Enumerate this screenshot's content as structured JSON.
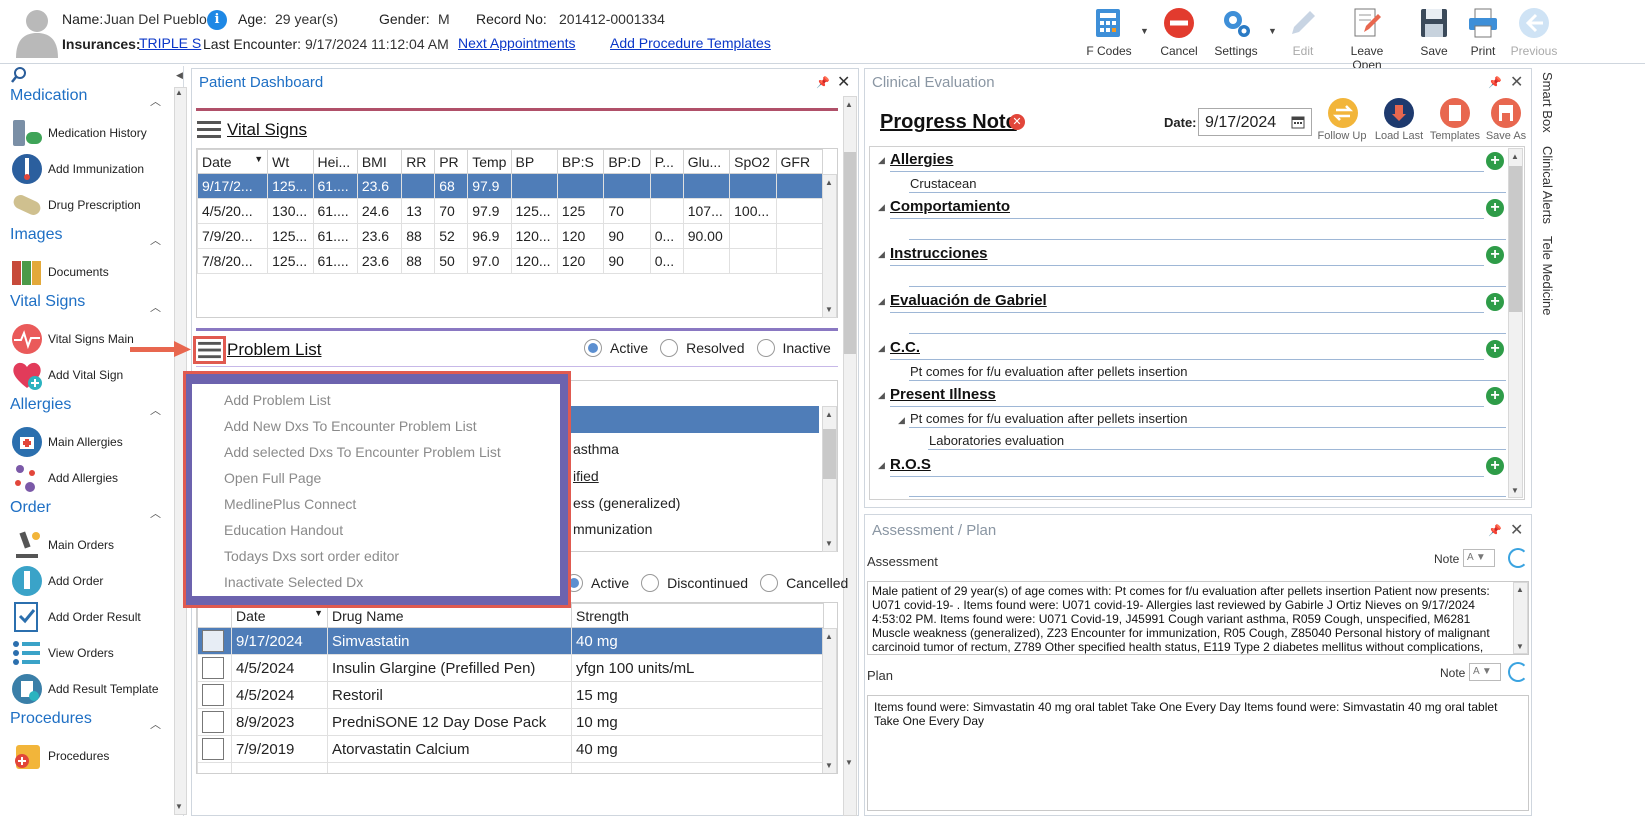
{
  "patient": {
    "name_label": "Name:",
    "name": "Juan Del Pueblo",
    "age_label": "Age:",
    "age": "29 year(s)",
    "gender_label": "Gender:",
    "gender": "M",
    "record_label": "Record No:",
    "record": "201412-0001334",
    "insurances_label": "Insurances:",
    "insurance": "TRIPLE S",
    "last_encounter_label": "Last Encounter:",
    "last_encounter": "9/17/2024 11:12:04 AM",
    "next_appointments": "Next Appointments",
    "add_procedure_templates": "Add Procedure Templates"
  },
  "toolbar": {
    "fcodes": "F Codes",
    "cancel": "Cancel",
    "settings": "Settings",
    "edit": "Edit",
    "leave_open": "Leave Open",
    "save": "Save",
    "print": "Print",
    "previous": "Previous"
  },
  "sidebar": {
    "sections": [
      {
        "title": "Medication",
        "items": [
          "Medication History",
          "Add Immunization",
          "Drug Prescription"
        ]
      },
      {
        "title": "Images",
        "items": [
          "Documents"
        ]
      },
      {
        "title": "Vital Signs",
        "items": [
          "Vital Signs Main",
          "Add Vital Sign"
        ]
      },
      {
        "title": "Allergies",
        "items": [
          "Main Allergies",
          "Add Allergies"
        ]
      },
      {
        "title": "Order",
        "items": [
          "Main Orders",
          "Add Order",
          "Add Order Result",
          "View Orders",
          "Add Result Template"
        ]
      },
      {
        "title": "Procedures",
        "items": [
          "Procedures"
        ]
      }
    ]
  },
  "dashboard": {
    "title": "Patient Dashboard",
    "vital_signs": {
      "title": "Vital Signs",
      "columns": [
        "Date",
        "Wt",
        "Hei...",
        "BMI",
        "RR",
        "PR",
        "Temp",
        "BP",
        "BP:S",
        "BP:D",
        "P...",
        "Glu...",
        "SpO2",
        "GFR"
      ],
      "rows": [
        [
          "9/17/2...",
          "125...",
          "61....",
          "23.6",
          "",
          "68",
          "97.9",
          "",
          "",
          "",
          "",
          "",
          "",
          ""
        ],
        [
          "4/5/20...",
          "130...",
          "61....",
          "24.6",
          "13",
          "70",
          "97.9",
          "125...",
          "125",
          "70",
          "",
          "107...",
          "100...",
          ""
        ],
        [
          "7/9/20...",
          "125...",
          "61....",
          "23.6",
          "88",
          "52",
          "96.9",
          "120...",
          "120",
          "90",
          "0...",
          "90.00",
          "",
          ""
        ],
        [
          "7/8/20...",
          "125...",
          "61....",
          "23.6",
          "88",
          "50",
          "97.0",
          "120...",
          "120",
          "90",
          "0...",
          "",
          "",
          ""
        ]
      ]
    },
    "problem_list": {
      "title": "Problem List",
      "filters": [
        "Active",
        "Resolved",
        "Inactive"
      ],
      "selected_filter": "Active",
      "visible_fragments": [
        "asthma",
        "ified",
        "ess (generalized)",
        "mmunization"
      ]
    },
    "context_menu": {
      "items": [
        "Add Problem List",
        "Add New Dxs To Encounter Problem List",
        "Add selected Dxs To Encounter Problem List",
        "Open Full Page",
        "MedlinePlus Connect",
        "Education Handout",
        "Todays Dxs sort order editor",
        "Inactivate Selected Dx"
      ]
    },
    "medications": {
      "filters": [
        "Active",
        "Discontinued",
        "Cancelled"
      ],
      "columns": [
        "Date",
        "Drug Name",
        "Strength"
      ],
      "rows": [
        [
          "9/17/2024",
          "Simvastatin",
          "40 mg"
        ],
        [
          "4/5/2024",
          "Insulin Glargine (Prefilled Pen)",
          "yfgn 100 units/mL"
        ],
        [
          "4/5/2024",
          "Restoril",
          "15 mg"
        ],
        [
          "8/9/2023",
          "PredniSONE 12 Day Dose Pack",
          "10 mg"
        ],
        [
          "7/9/2019",
          "Atorvastatin Calcium",
          "40 mg"
        ]
      ]
    }
  },
  "clinical": {
    "title": "Clinical Evaluation",
    "note_title": "Progress Note",
    "date_label": "Date:",
    "date": "9/17/2024",
    "actions": [
      "Follow Up",
      "Load Last",
      "Templates",
      "Save As"
    ],
    "sections": [
      {
        "title": "Allergies",
        "lines": [
          "Crustacean"
        ]
      },
      {
        "title": "Comportamiento",
        "lines": []
      },
      {
        "title": "Instrucciones",
        "lines": []
      },
      {
        "title": "Evaluación de Gabriel",
        "lines": []
      },
      {
        "title": "C.C.",
        "lines": [
          "Pt comes for f/u evaluation after pellets insertion"
        ]
      },
      {
        "title": "Present Illness",
        "lines": [
          "Pt comes for f/u evaluation after pellets insertion",
          "Laboratories evaluation"
        ]
      },
      {
        "title": "R.O.S",
        "lines": []
      }
    ]
  },
  "side_tabs": [
    "Smart Box",
    "Clinical Alerts",
    "Tele Medicine"
  ],
  "assessment_plan": {
    "title": "Assessment / Plan",
    "assessment_label": "Assessment",
    "note_label": "Note",
    "assessment_text": "Male patient of 29 year(s) of age comes with:  Pt comes for f/u evaluation after pellets insertion  Patient now presents: U071 covid-19- . Items found were:  U071 covid-19-    Allergies last reviewed by Gabirle J Ortiz Nieves on 9/17/2024 4:53:02 PM.     Items found were:  U071 Covid-19, J45991 Cough variant asthma, R059 Cough, unspecified, M6281 Muscle weakness (generalized), Z23 Encounter for immunization, R05 Cough, Z85040 Personal history of malignant carcinoid tumor of rectum, Z789 Other specified health status, E119 Type 2 diabetes mellitus without complications,",
    "plan_label": "Plan",
    "plan_text": "  Items found were:  Simvastatin 40 mg oral tablet Take One Every Day   Items found were:  Simvastatin 40 mg oral tablet Take One Every Day"
  },
  "colors": {
    "accent": "#1e6fc4",
    "selected_row": "#4f7db8",
    "menu_border": "#e05a50",
    "menu_frame": "#6c63ae",
    "add_green": "#2e9c48",
    "arrow": "#e8674f"
  }
}
